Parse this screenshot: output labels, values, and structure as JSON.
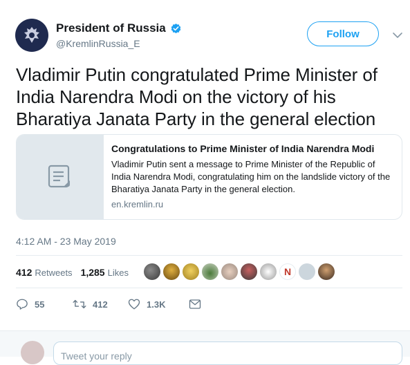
{
  "account": {
    "name": "President of Russia",
    "handle": "@KremlinRussia_E",
    "follow_label": "Follow"
  },
  "tweet": {
    "text": "Vladimir Putin congratulated Prime Minister of India Narendra Modi on the victory of his Bharatiya Janata Party in the general election",
    "timestamp": "4:12 AM - 23 May 2019"
  },
  "card": {
    "title": "Congratulations to Prime Minister of India Narendra Modi",
    "description": "Vladimir Putin sent a message to Prime Minister of the Republic of India Narendra Modi, congratulating him on the landslide victory of the Bharatiya Janata Party in the general election.",
    "domain": "en.kremlin.ru"
  },
  "stats": {
    "retweets_count": "412",
    "retweets_label": "Retweets",
    "likes_count": "1,285",
    "likes_label": "Likes"
  },
  "actions": {
    "reply_count": "55",
    "retweet_count": "412",
    "like_count": "1.3K"
  },
  "reply": {
    "placeholder": "Tweet your reply"
  },
  "colors": {
    "accent": "#1da1f2",
    "muted": "#657786",
    "text": "#14171a"
  },
  "icons": [
    "coat-of-arms-icon",
    "verified-icon",
    "chevron-down-icon",
    "document-icon",
    "reply-icon",
    "retweet-icon",
    "heart-icon",
    "message-icon"
  ]
}
